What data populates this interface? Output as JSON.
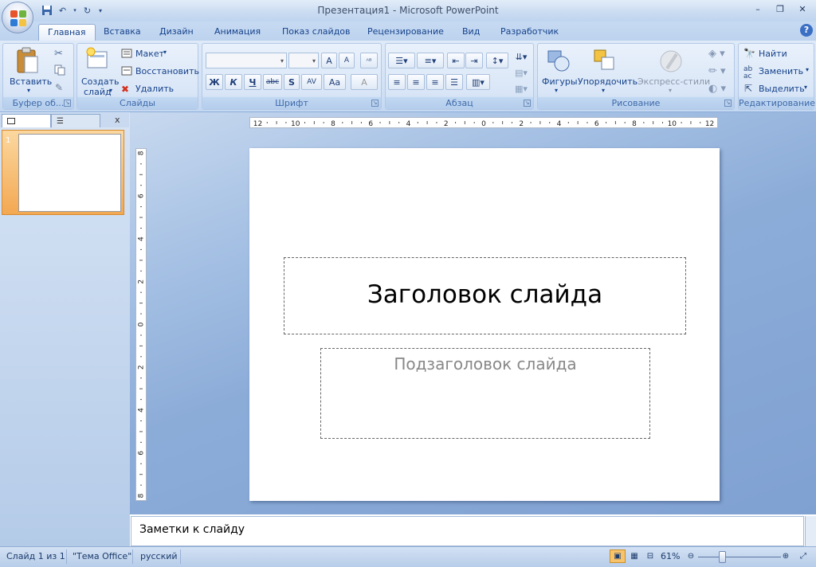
{
  "window": {
    "title": "Презентация1 - Microsoft PowerPoint",
    "controls": [
      "–",
      "❐",
      "✕"
    ]
  },
  "tabs": [
    {
      "label": "Главная",
      "active": true
    },
    {
      "label": "Вставка"
    },
    {
      "label": "Дизайн"
    },
    {
      "label": "Анимация"
    },
    {
      "label": "Показ слайдов"
    },
    {
      "label": "Рецензирование"
    },
    {
      "label": "Вид"
    },
    {
      "label": "Разработчик"
    }
  ],
  "help_icon": "?",
  "ribbon": {
    "clipboard": {
      "title": "Буфер об...",
      "paste_label": "Вставить"
    },
    "slides": {
      "title": "Слайды",
      "new_slide_label_1": "Создать",
      "new_slide_label_2": "слайд",
      "layout_label": "Макет",
      "reset_label": "Восстановить",
      "delete_label": "Удалить"
    },
    "font": {
      "title": "Шрифт",
      "bold": "Ж",
      "italic": "К",
      "underline": "Ч",
      "strike": "abc",
      "shadow": "S",
      "spacing": "AV",
      "case": "Aa",
      "color": "A",
      "grow": "A",
      "shrink": "A"
    },
    "paragraph": {
      "title": "Абзац"
    },
    "drawing": {
      "title": "Рисование",
      "shapes_label": "Фигуры",
      "arrange_label": "Упорядочить",
      "styles_label": "Экспресс-стили"
    },
    "editing": {
      "title": "Редактирование",
      "find_label": "Найти",
      "replace_label": "Заменить",
      "select_label": "Выделить"
    }
  },
  "panel": {
    "close": "x",
    "slide_number": "1"
  },
  "rulers": {
    "h_labels": [
      "12",
      "10",
      "8",
      "6",
      "4",
      "2",
      "0",
      "2",
      "4",
      "6",
      "8",
      "10",
      "12"
    ],
    "v_labels": [
      "8",
      "6",
      "4",
      "2",
      "0",
      "2",
      "4",
      "6",
      "8"
    ]
  },
  "slide": {
    "title_placeholder": "Заголовок слайда",
    "subtitle_placeholder": "Подзаголовок слайда"
  },
  "notes": {
    "placeholder": "Заметки к слайду"
  },
  "status": {
    "slide_info": "Слайд 1 из 1",
    "theme": "\"Тема Office\"",
    "language": "русский",
    "zoom": "61%"
  },
  "colors": {
    "accent": "#15428b",
    "ribbon": "#d1e1f5",
    "selection": "#f3a852"
  }
}
